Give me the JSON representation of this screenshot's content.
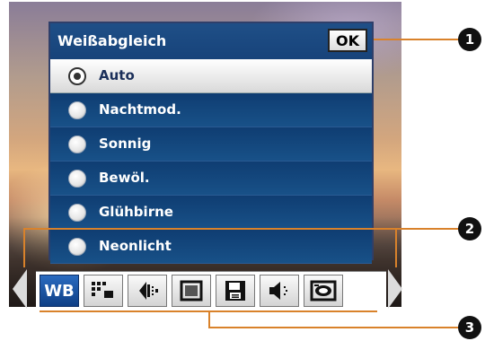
{
  "dialog": {
    "title": "Weißabgleich",
    "ok_label": "OK",
    "options": [
      {
        "label": "Auto",
        "selected": true
      },
      {
        "label": "Nachtmod.",
        "selected": false
      },
      {
        "label": "Sonnig",
        "selected": false
      },
      {
        "label": "Bewöl.",
        "selected": false
      },
      {
        "label": "Glühbirne",
        "selected": false
      },
      {
        "label": "Neonlicht",
        "selected": false
      }
    ]
  },
  "toolbar": {
    "wb_label": "WB",
    "buttons": [
      "wb-icon",
      "grid-icon",
      "exposure-icon",
      "frame-icon",
      "save-icon",
      "sound-icon",
      "camera-icon"
    ]
  },
  "callouts": [
    "1",
    "2",
    "3"
  ],
  "colors": {
    "panel_bg": "#14457e",
    "accent_active": "#0f3f85",
    "callout_line": "#d9822b"
  }
}
